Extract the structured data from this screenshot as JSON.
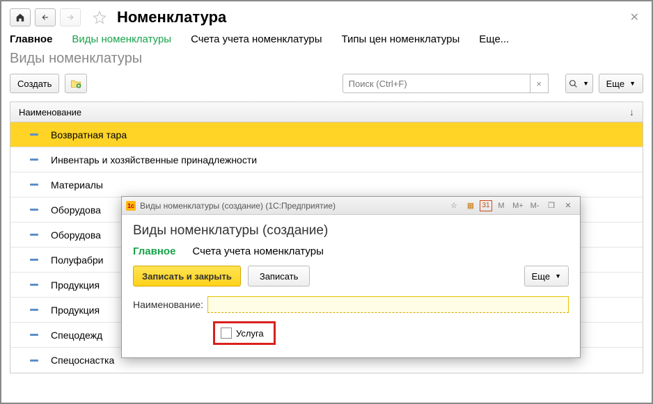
{
  "header": {
    "title": "Номенклатура"
  },
  "tabs": {
    "main": "Главное",
    "types": "Виды номенклатуры",
    "accounts": "Счета учета номенклатуры",
    "priceTypes": "Типы цен номенклатуры",
    "more": "Еще..."
  },
  "section": {
    "title": "Виды номенклатуры"
  },
  "toolbar": {
    "create": "Создать",
    "searchPlaceholder": "Поиск (Ctrl+F)",
    "more": "Еще"
  },
  "table": {
    "header": "Наименование",
    "rows": [
      "Возвратная тара",
      "Инвентарь и хозяйственные принадлежности",
      "Материалы",
      "Оборудова",
      "Оборудова",
      "Полуфабри",
      "Продукция",
      "Продукция",
      "Спецодежд",
      "Спецоснастка"
    ]
  },
  "dialog": {
    "windowTitle": "Виды номенклатуры (создание)  (1С:Предприятие)",
    "toolbarMarks": {
      "m": "M",
      "mplus": "M+",
      "mminus": "M-"
    },
    "heading": "Виды номенклатуры (создание)",
    "tabs": {
      "main": "Главное",
      "accounts": "Счета учета номенклатуры"
    },
    "actions": {
      "saveClose": "Записать и закрыть",
      "save": "Записать",
      "more": "Еще"
    },
    "fields": {
      "nameLabel": "Наименование:",
      "serviceLabel": "Услуга"
    }
  }
}
